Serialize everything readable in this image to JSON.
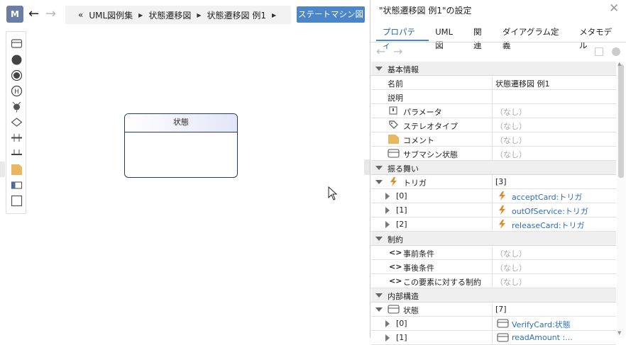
{
  "left": {
    "badge": "M",
    "breadcrumb": {
      "start": "«",
      "items": [
        "UML図例集",
        "状態遷移図",
        "状態遷移図 例1"
      ]
    },
    "mode_button": "ステートマシン図",
    "state_node": {
      "label": "状態"
    },
    "palette_icons": [
      "state-icon",
      "initial-state-icon",
      "final-state-icon",
      "history-icon",
      "choice-icon",
      "decision-icon",
      "fork-icon",
      "join-icon",
      "note-icon",
      "submachine-icon",
      "rectangle-icon"
    ]
  },
  "panel": {
    "title": "\"状態遷移図 例1\"の設定",
    "tabs": [
      "プロパティ",
      "UML図",
      "関連",
      "ダイアグラム定義",
      "メタモデル"
    ],
    "active_tab": "プロパティ",
    "sections": {
      "basic": {
        "header": "基本情報",
        "name_label": "名前",
        "name_value": "状態遷移図 例1",
        "desc_label": "説明",
        "param_label": "パラメータ",
        "param_value": "（なし）",
        "stereo_label": "ステレオタイプ",
        "stereo_value": "（なし）",
        "comment_label": "コメント",
        "comment_value": "（なし）",
        "submachine_label": "サブマシン状態",
        "submachine_value": "（なし）"
      },
      "behavior": {
        "header": "振る舞い",
        "trigger_label": "トリガ",
        "trigger_count": "[3]",
        "items": [
          {
            "index": "[0]",
            "value": "acceptCard:トリガ"
          },
          {
            "index": "[1]",
            "value": "outOfService:トリガ"
          },
          {
            "index": "[2]",
            "value": "releaseCard:トリガ"
          }
        ]
      },
      "constraints": {
        "header": "制約",
        "pre_label": "事前条件",
        "pre_value": "（なし）",
        "post_label": "事後条件",
        "post_value": "（なし）",
        "elem_label": "この要素に対する制約",
        "elem_value": "（なし）"
      },
      "internal": {
        "header": "内部構造",
        "state_label": "状態",
        "state_count": "[7]",
        "items": [
          {
            "index": "[0]",
            "value": "VerifyCard:状態"
          },
          {
            "index": "[1]",
            "value": "readAmount :..."
          }
        ]
      }
    }
  }
}
